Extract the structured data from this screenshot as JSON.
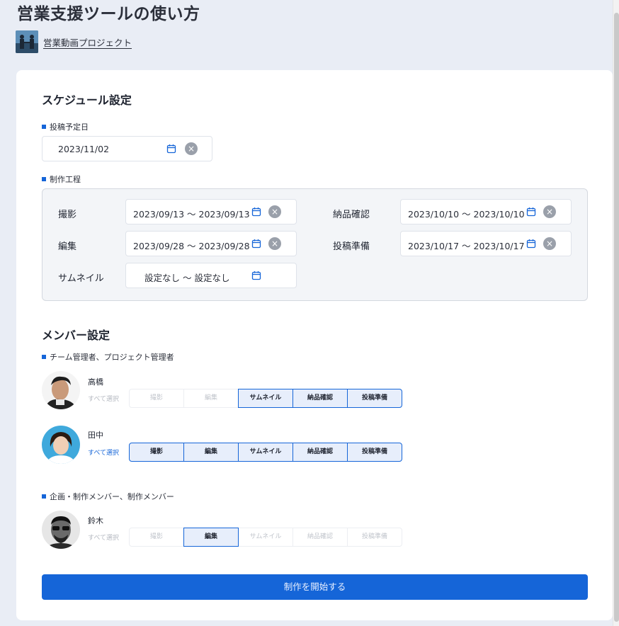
{
  "page_title": "営業支援ツールの使い方",
  "project_link": "営業動画プロジェクト",
  "schedule": {
    "title": "スケジュール設定",
    "post_date_label": "投稿予定日",
    "post_date_value": "2023/11/02",
    "process_label": "制作工程",
    "processes": [
      {
        "name": "撮影",
        "range": "2023/09/13 〜 2023/09/13",
        "clearable": true
      },
      {
        "name": "編集",
        "range": "2023/09/28 〜 2023/09/28",
        "clearable": true
      },
      {
        "name": "サムネイル",
        "range": "設定なし 〜 設定なし",
        "clearable": false
      },
      {
        "name": "納品確認",
        "range": "2023/10/10 〜 2023/10/10",
        "clearable": true
      },
      {
        "name": "投稿準備",
        "range": "2023/10/17 〜 2023/10/17",
        "clearable": true
      }
    ]
  },
  "members": {
    "title": "メンバー設定",
    "managers_label": "チーム管理者、プロジェクト管理者",
    "creators_label": "企画・制作メンバー、制作メンバー",
    "select_all_label": "すべて選択",
    "task_labels": [
      "撮影",
      "編集",
      "サムネイル",
      "納品確認",
      "投稿準備"
    ],
    "people": [
      {
        "name": "高橋",
        "selected": [
          false,
          false,
          true,
          true,
          true
        ],
        "all_selected": false
      },
      {
        "name": "田中",
        "selected": [
          true,
          true,
          true,
          true,
          true
        ],
        "all_selected": true
      },
      {
        "name": "鈴木",
        "selected": [
          false,
          true,
          false,
          false,
          false
        ],
        "all_selected": false
      }
    ]
  },
  "start_button": "制作を開始する",
  "colors": {
    "accent": "#1565d8",
    "background": "#e9edf5"
  }
}
